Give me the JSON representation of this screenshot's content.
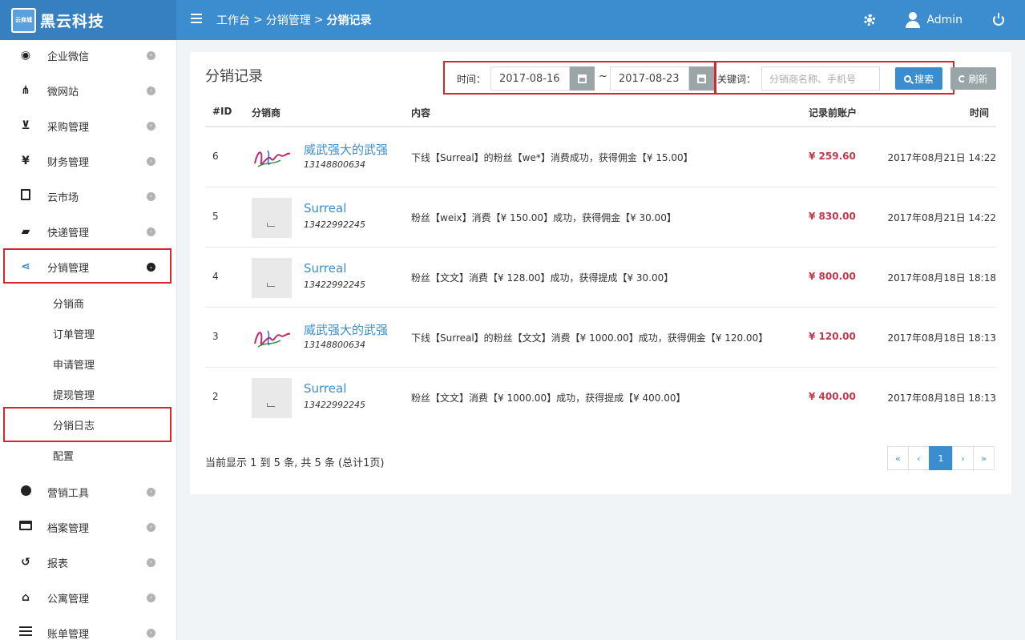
{
  "brand": {
    "logo_text": "云商城",
    "name": "黑云科技"
  },
  "breadcrumb": [
    "工作台",
    "分销管理",
    "分销记录"
  ],
  "breadcrumb_sep": ">",
  "user": {
    "name": "Admin"
  },
  "sidebar": {
    "items": [
      {
        "label": "企业微信",
        "icon": "wechat-icon"
      },
      {
        "label": "微网站",
        "icon": "sitemap-icon"
      },
      {
        "label": "采购管理",
        "icon": "cart-icon"
      },
      {
        "label": "财务管理",
        "icon": "yen-icon"
      },
      {
        "label": "云市场",
        "icon": "building-icon"
      },
      {
        "label": "快递管理",
        "icon": "truck-icon"
      },
      {
        "label": "分销管理",
        "icon": "share-icon",
        "expanded": true
      },
      {
        "label": "营销工具",
        "icon": "globe-icon"
      },
      {
        "label": "档案管理",
        "icon": "credit-card-icon"
      },
      {
        "label": "报表",
        "icon": "history-icon"
      },
      {
        "label": "公寓管理",
        "icon": "home-icon"
      },
      {
        "label": "账单管理",
        "icon": "list-icon"
      }
    ],
    "sub_items": [
      "分销商",
      "订单管理",
      "申请管理",
      "提现管理",
      "分销日志",
      "配置"
    ],
    "active_sub": "分销日志"
  },
  "panel": {
    "title": "分销记录",
    "time_label": "时间：",
    "date_from": "2017-08-16",
    "date_sep": "~",
    "date_to": "2017-08-23",
    "keyword_label": "关键词：",
    "keyword_placeholder": "分销商名称、手机号",
    "search_label": "搜索",
    "refresh_label": "刷新"
  },
  "table": {
    "headers": {
      "id": "#ID",
      "distributor": "分销商",
      "content": "内容",
      "balance": "记录前账户",
      "time": "时间"
    },
    "rows": [
      {
        "id": "6",
        "name": "威武强大的武强",
        "phone": "13148800634",
        "content": "下线【Surreal】的粉丝【we*】消费成功，获得佣金【¥ 15.00】",
        "balance": "¥ 259.60",
        "time": "2017年08月21日 14:22",
        "avatar": "signature"
      },
      {
        "id": "5",
        "name": "Surreal",
        "phone": "13422992245",
        "content": "粉丝【weix】消费【¥ 150.00】成功，获得佣金【¥ 30.00】",
        "balance": "¥ 830.00",
        "time": "2017年08月21日 14:22",
        "avatar": "blank"
      },
      {
        "id": "4",
        "name": "Surreal",
        "phone": "13422992245",
        "content": "粉丝【文文】消费【¥ 128.00】成功，获得提成【¥ 30.00】",
        "balance": "¥ 800.00",
        "time": "2017年08月18日 18:18",
        "avatar": "blank"
      },
      {
        "id": "3",
        "name": "威武强大的武强",
        "phone": "13148800634",
        "content": "下线【Surreal】的粉丝【文文】消费【¥ 1000.00】成功，获得佣金【¥ 120.00】",
        "balance": "¥ 120.00",
        "time": "2017年08月18日 18:13",
        "avatar": "signature"
      },
      {
        "id": "2",
        "name": "Surreal",
        "phone": "13422992245",
        "content": "粉丝【文文】消费【¥ 1000.00】成功，获得提成【¥ 400.00】",
        "balance": "¥ 400.00",
        "time": "2017年08月18日 18:13",
        "avatar": "blank"
      }
    ]
  },
  "footer": {
    "summary": "当前显示 1 到 5 条, 共 5 条 (总计1页)"
  },
  "pagination": {
    "first": "«",
    "prev": "‹",
    "current": "1",
    "next": "›",
    "last": "»"
  },
  "colors": {
    "primary": "#3c8dd0",
    "balance": "#c3374d",
    "highlight_box": "#d9262c"
  }
}
